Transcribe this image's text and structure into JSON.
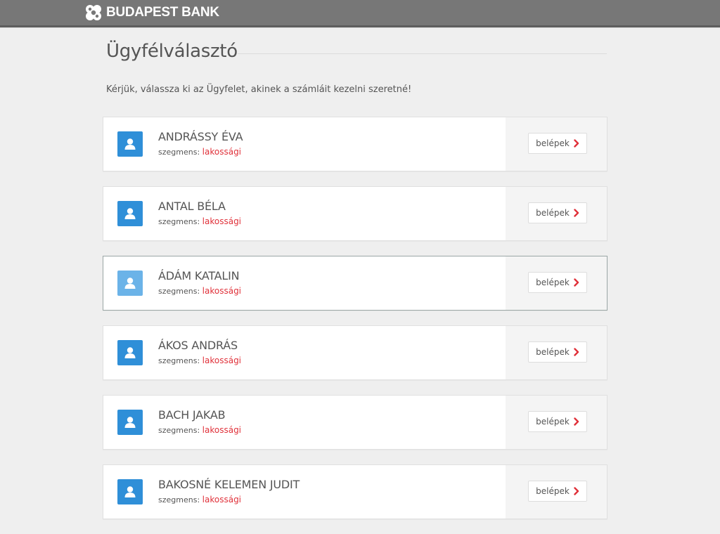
{
  "header": {
    "brand": "BUDAPEST BANK",
    "logo_icon": "budapest-bank-logo-icon",
    "background": "#777777"
  },
  "page": {
    "title": "Ügyfélválasztó",
    "intro": "Kérjük, válassza ki az Ügyfelet, akinek a számláit kezelni szeretné!"
  },
  "clients": [
    {
      "name": "ANDRÁSSY ÉVA",
      "segment_label": "szegmens:",
      "segment": "lakossági",
      "button": "belépek",
      "active": false
    },
    {
      "name": "ANTAL BÉLA",
      "segment_label": "szegmens:",
      "segment": "lakossági",
      "button": "belépek",
      "active": false
    },
    {
      "name": "ÁDÁM KATALIN",
      "segment_label": "szegmens:",
      "segment": "lakossági",
      "button": "belépek",
      "active": true
    },
    {
      "name": "ÁKOS ANDRÁS",
      "segment_label": "szegmens:",
      "segment": "lakossági",
      "button": "belépek",
      "active": false
    },
    {
      "name": "BACH JAKAB",
      "segment_label": "szegmens:",
      "segment": "lakossági",
      "button": "belépek",
      "active": false
    },
    {
      "name": "BAKOSNÉ KELEMEN JUDIT",
      "segment_label": "szegmens:",
      "segment": "lakossági",
      "button": "belépek",
      "active": false
    }
  ],
  "icons": {
    "avatar": "user-icon",
    "button_arrow": "chevron-right-icon"
  },
  "colors": {
    "accent_red": "#e0313a",
    "avatar_blue": "#2f8fd8",
    "avatar_blue_active": "#6bb3e8"
  }
}
